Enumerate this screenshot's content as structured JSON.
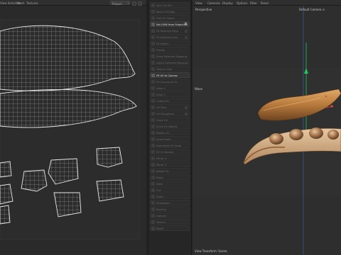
{
  "uv_editor": {
    "menu": [
      "View Selection",
      "Mesh",
      "Textures"
    ],
    "project_select": "Project"
  },
  "tool_panel": {
    "items": [
      {
        "label": "Sync UV Sel.",
        "active": false
      },
      {
        "label": "Relax UV Edge",
        "active": false
      },
      {
        "label": "Grid UV Island",
        "active": false
      },
      {
        "label": "Set UVW from Projection",
        "active": true,
        "gear": true
      },
      {
        "label": "Fit Selected Polys",
        "active": false,
        "mini": true
      },
      {
        "label": "Fit Selected Area",
        "active": false,
        "mini": true
      },
      {
        "label": "Fit Object",
        "active": false
      },
      {
        "label": "Frontal",
        "active": false
      },
      {
        "label": "Show Selected Mapping",
        "active": false
      },
      {
        "label": "Adjust Selected Mapping",
        "active": false
      },
      {
        "label": "Texture Size",
        "active": false
      },
      {
        "label": "Fit UV to Canvas",
        "active": true
      },
      {
        "label": "Fit Canvas to UV",
        "active": false
      },
      {
        "label": "Align U",
        "active": false
      },
      {
        "label": "Align V",
        "active": false
      },
      {
        "label": "Unfold UV",
        "active": false
      },
      {
        "label": "UV Pack",
        "active": false,
        "mini": true
      },
      {
        "label": "UV Straighten",
        "active": false,
        "mini": true
      },
      {
        "label": "Stack UV",
        "active": false
      },
      {
        "label": "Scale UV Islands",
        "active": false
      },
      {
        "label": "Rotate UV",
        "active": false
      },
      {
        "label": "Snap Pixels",
        "active": false
      },
      {
        "label": "Normalize UV Scale",
        "active": false
      },
      {
        "label": "Fit UV Islands",
        "active": false
      },
      {
        "label": "Mirror U",
        "active": false
      },
      {
        "label": "Mirror V",
        "active": false
      },
      {
        "label": "Rotate 90",
        "active": false
      },
      {
        "label": "Relax",
        "active": false
      },
      {
        "label": "Weld",
        "active": false
      },
      {
        "label": "Cut",
        "active": false
      },
      {
        "label": "Stitch",
        "active": false
      },
      {
        "label": "Straighten",
        "active": false
      },
      {
        "label": "Packing",
        "active": false
      },
      {
        "label": "Options",
        "active": false
      },
      {
        "label": "Texture",
        "active": false
      },
      {
        "label": "Reset",
        "active": false
      }
    ]
  },
  "viewport": {
    "menu": [
      "View",
      "Cameras",
      "Display",
      "Options",
      "Filter",
      "Panel"
    ],
    "perspective_label": "Perspective",
    "camera_label": "Default Camera ⊙",
    "side_label": "Wave",
    "bottom_label": "View Transform: Scene",
    "colors": {
      "axis_y": "#22c55e",
      "axis_x": "#ef4444",
      "axis_z": "#3b82f6",
      "pod": "#c6894a"
    }
  }
}
